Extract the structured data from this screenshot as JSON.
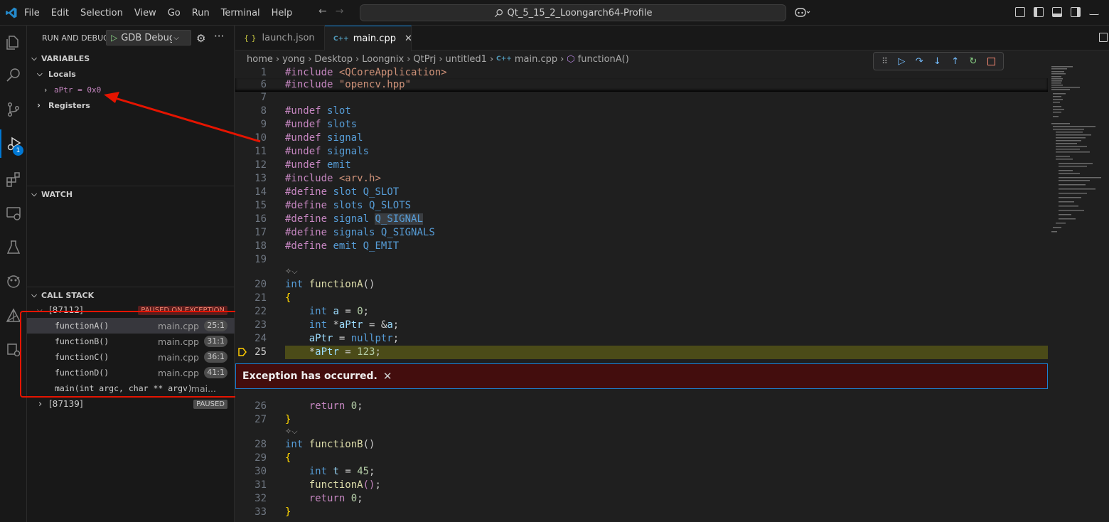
{
  "menu": [
    "File",
    "Edit",
    "Selection",
    "View",
    "Go",
    "Run",
    "Terminal",
    "Help"
  ],
  "search": {
    "text": "Qt_5_15_2_Loongarch64-Profile"
  },
  "sidebar": {
    "header": "RUN AND DEBUG",
    "config": "GDB Debug",
    "variables": {
      "title": "VARIABLES",
      "locals": "Locals",
      "local_var": "aPtr = 0x0",
      "registers": "Registers"
    },
    "watch": {
      "title": "WATCH"
    },
    "callstack": {
      "title": "CALL STACK",
      "thread1": "[87112]",
      "thread1_status": "PAUSED ON EXCEPTION",
      "frames": [
        {
          "fn": "functionA()",
          "file": "main.cpp",
          "loc": "25:1"
        },
        {
          "fn": "functionB()",
          "file": "main.cpp",
          "loc": "31:1"
        },
        {
          "fn": "functionC()",
          "file": "main.cpp",
          "loc": "36:1"
        },
        {
          "fn": "functionD()",
          "file": "main.cpp",
          "loc": "41:1"
        },
        {
          "fn": "main(int argc, char ** argv)",
          "file": "mai..."
        }
      ],
      "thread2": "[87139]",
      "thread2_status": "PAUSED"
    }
  },
  "badge_count": "1",
  "tabs": [
    {
      "label": "launch.json",
      "icon": "{ }"
    },
    {
      "label": "main.cpp",
      "icon": "C++"
    }
  ],
  "breadcrumbs": [
    "home",
    "yong",
    "Desktop",
    "Loongnix",
    "QtPrj",
    "untitled1",
    "main.cpp",
    "functionA()"
  ],
  "code": {
    "line_numbers": [
      "1",
      "6",
      "7",
      "8",
      "9",
      "10",
      "11",
      "12",
      "13",
      "14",
      "15",
      "16",
      "17",
      "18",
      "19",
      "20",
      "21",
      "22",
      "23",
      "24",
      "25",
      "26",
      "27",
      "28",
      "29",
      "30",
      "31",
      "32",
      "33"
    ]
  },
  "exception": {
    "message": "Exception has occurred."
  },
  "colors": {
    "accent": "#0078d4",
    "exception_bg": "#430d0d",
    "annotation_red": "#e51400"
  }
}
